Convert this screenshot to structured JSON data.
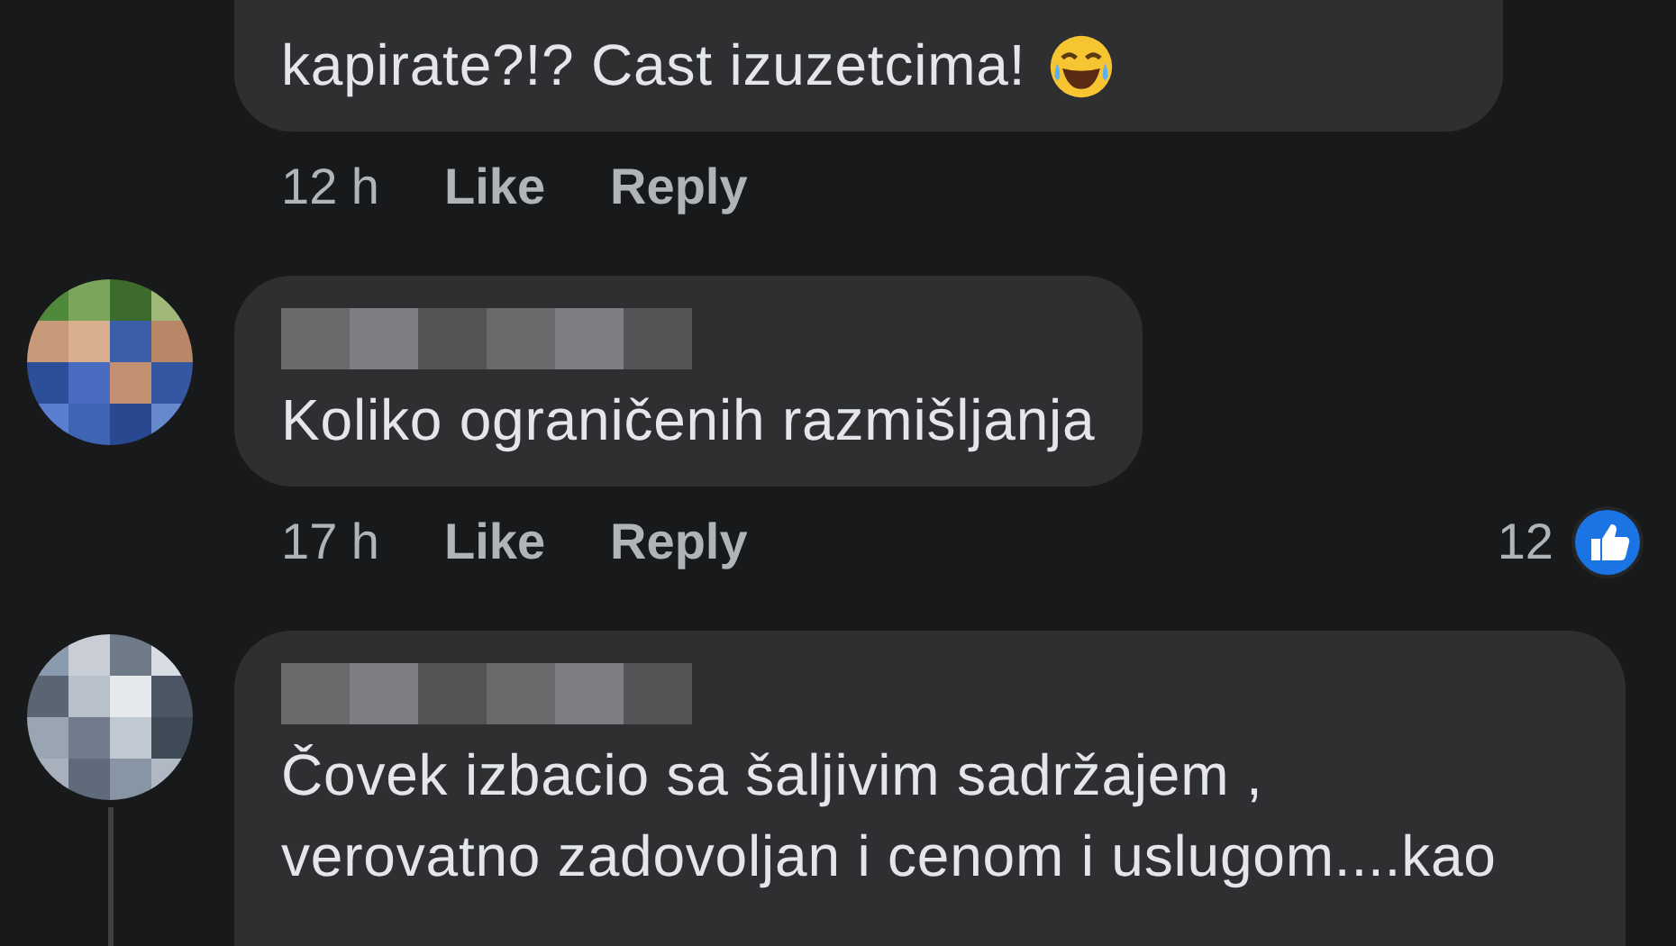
{
  "comments": [
    {
      "kind": "continuation",
      "lines": [
        "kapirate?!? Cast izuzetcima!"
      ],
      "emoji": true,
      "time": "12 h",
      "actions": [
        "Like",
        "Reply"
      ]
    },
    {
      "kind": "comment",
      "lines": [
        "Koliko ograničenih razmišljanja"
      ],
      "time": "17 h",
      "actions": [
        "Like",
        "Reply"
      ],
      "reaction_count": "12"
    },
    {
      "kind": "comment",
      "lines": [
        "Čovek izbacio sa šaljivim sadržajem ,",
        "verovatno zadovoljan i cenom i uslugom....kao"
      ]
    }
  ]
}
